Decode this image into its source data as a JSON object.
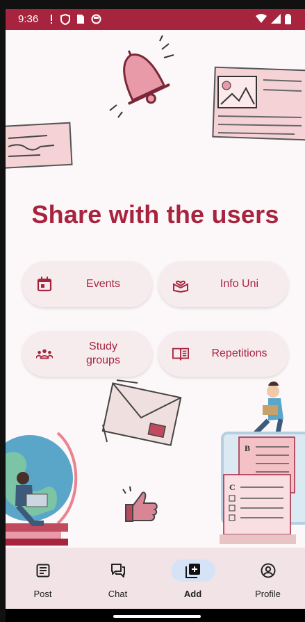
{
  "status_bar": {
    "time": "9:36"
  },
  "headline": "Share with the users",
  "actions": [
    {
      "label": "Events",
      "icon": "calendar-icon"
    },
    {
      "label": "Info Uni",
      "icon": "book-heart-icon"
    },
    {
      "label": "Study\ngroups",
      "icon": "groups-icon"
    },
    {
      "label": "Repetitions",
      "icon": "open-book-icon"
    }
  ],
  "nav": [
    {
      "label": "Post",
      "icon": "article-icon",
      "active": false
    },
    {
      "label": "Chat",
      "icon": "chat-bubbles-icon",
      "active": false
    },
    {
      "label": "Add",
      "icon": "add-box-icon",
      "active": true
    },
    {
      "label": "Profile",
      "icon": "account-circle-icon",
      "active": false
    }
  ],
  "colors": {
    "accent": "#a7243f",
    "chip_bg": "#f6ecee",
    "nav_bg": "#f2e3e6",
    "active_pill": "#d6e3f7"
  }
}
